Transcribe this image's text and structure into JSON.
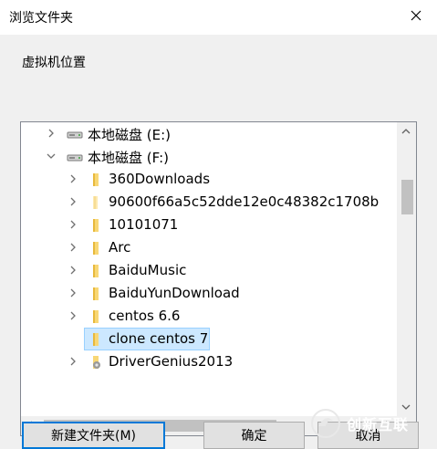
{
  "window": {
    "title": "浏览文件夹",
    "close_icon": "close-icon"
  },
  "prompt": "虚拟机位置",
  "tree": {
    "items": [
      {
        "label": "本地磁盘 (E:)",
        "type": "drive",
        "expanded": false,
        "has_children": true,
        "level": 0
      },
      {
        "label": "本地磁盘 (F:)",
        "type": "drive",
        "expanded": true,
        "has_children": true,
        "level": 0
      },
      {
        "label": "360Downloads",
        "type": "folder",
        "has_children": true,
        "level": 1
      },
      {
        "label": "90600f66a5c52dde12e0c48382c1708b",
        "type": "folder-light",
        "has_children": true,
        "level": 1
      },
      {
        "label": "10101071",
        "type": "folder",
        "has_children": true,
        "level": 1
      },
      {
        "label": "Arc",
        "type": "folder",
        "has_children": true,
        "level": 1
      },
      {
        "label": "BaiduMusic",
        "type": "folder",
        "has_children": true,
        "level": 1
      },
      {
        "label": "BaiduYunDownload",
        "type": "folder",
        "has_children": true,
        "level": 1
      },
      {
        "label": "centos 6.6",
        "type": "folder",
        "has_children": true,
        "level": 1
      },
      {
        "label": "clone centos 7",
        "type": "folder",
        "has_children": false,
        "level": 1,
        "selected": true
      },
      {
        "label": "DriverGenius2013",
        "type": "folder-special",
        "has_children": true,
        "level": 1
      }
    ]
  },
  "buttons": {
    "new_folder": "新建文件夹(M)",
    "ok": "确定",
    "cancel": "取消"
  },
  "watermark": "创新互联",
  "colors": {
    "selection_bg": "#cce8ff",
    "selection_border": "#99d1ff",
    "folder_yellow": "#f8d775",
    "focus_border": "#0078d7"
  }
}
